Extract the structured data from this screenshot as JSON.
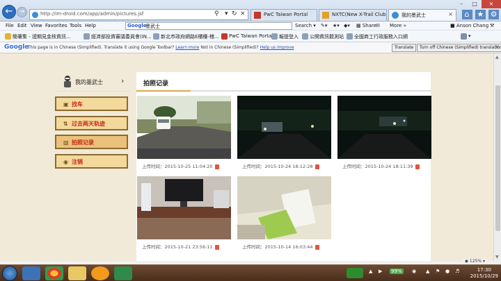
{
  "browser": {
    "address_url": "http://im-droid.com/app/admin/pictures.jsf",
    "tabs": [
      {
        "label": "PwC Taiwan Portal"
      },
      {
        "label": "NXTC(New X-Trail Club)"
      },
      {
        "label": "我的墨武士"
      }
    ],
    "menu": [
      "File",
      "Edit",
      "View",
      "Favorites",
      "Tools",
      "Help"
    ],
    "google_label": "Google",
    "google_query": "墨武士",
    "toolbar": {
      "search": "Search",
      "share": "Share",
      "more": "More »",
      "user": "Anson Chang"
    },
    "favorites": [
      "簡署集 - 證期見金核資訊...",
      "經濟部投資審議委員會(IN...",
      "新北市政府網路E櫃檯-稽...",
      "PwC Taiwan Portal",
      "報提登入",
      "公開資訊觀測站",
      "全國商工行政服務入口網"
    ],
    "translate": {
      "logo": "Google",
      "message": "This page is in Chinese (Simplified).  Translate it using Google Toolbar?",
      "learn_more": "Learn more",
      "not_in": "Not in Chinese (Simplified)?",
      "help": "Help us improve",
      "translate_btn": "Translate",
      "turnoff_btn": "Turn off Chinese (Simplified) translation"
    },
    "zoom": "125%"
  },
  "sidebar": {
    "user_name": "我的墨武士",
    "items": [
      {
        "label": "找车"
      },
      {
        "label": "过去两天轨迹"
      },
      {
        "label": "拍照记录"
      },
      {
        "label": "注销"
      }
    ]
  },
  "main": {
    "title": "拍照记录",
    "photos": [
      {
        "caption": "上传时间：2015-10-25 11:04:20"
      },
      {
        "caption": "上传时间：2015-10-24 18:12:28"
      },
      {
        "caption": "上传时间：2015-10-24 18:11:39"
      },
      {
        "caption": "上传时间：2015-10-21 23:56:11"
      },
      {
        "caption": "上传时间：2015-10-14 16:03:44"
      }
    ]
  },
  "taskbar": {
    "battery": "99%",
    "time": "17:30",
    "date": "2015/10/29"
  },
  "colors": {
    "page_bg": "#f2ead8",
    "sidebar_border": "#8b6a2e",
    "sidebar_text": "#c6261b",
    "accent": "#d4a94a"
  }
}
